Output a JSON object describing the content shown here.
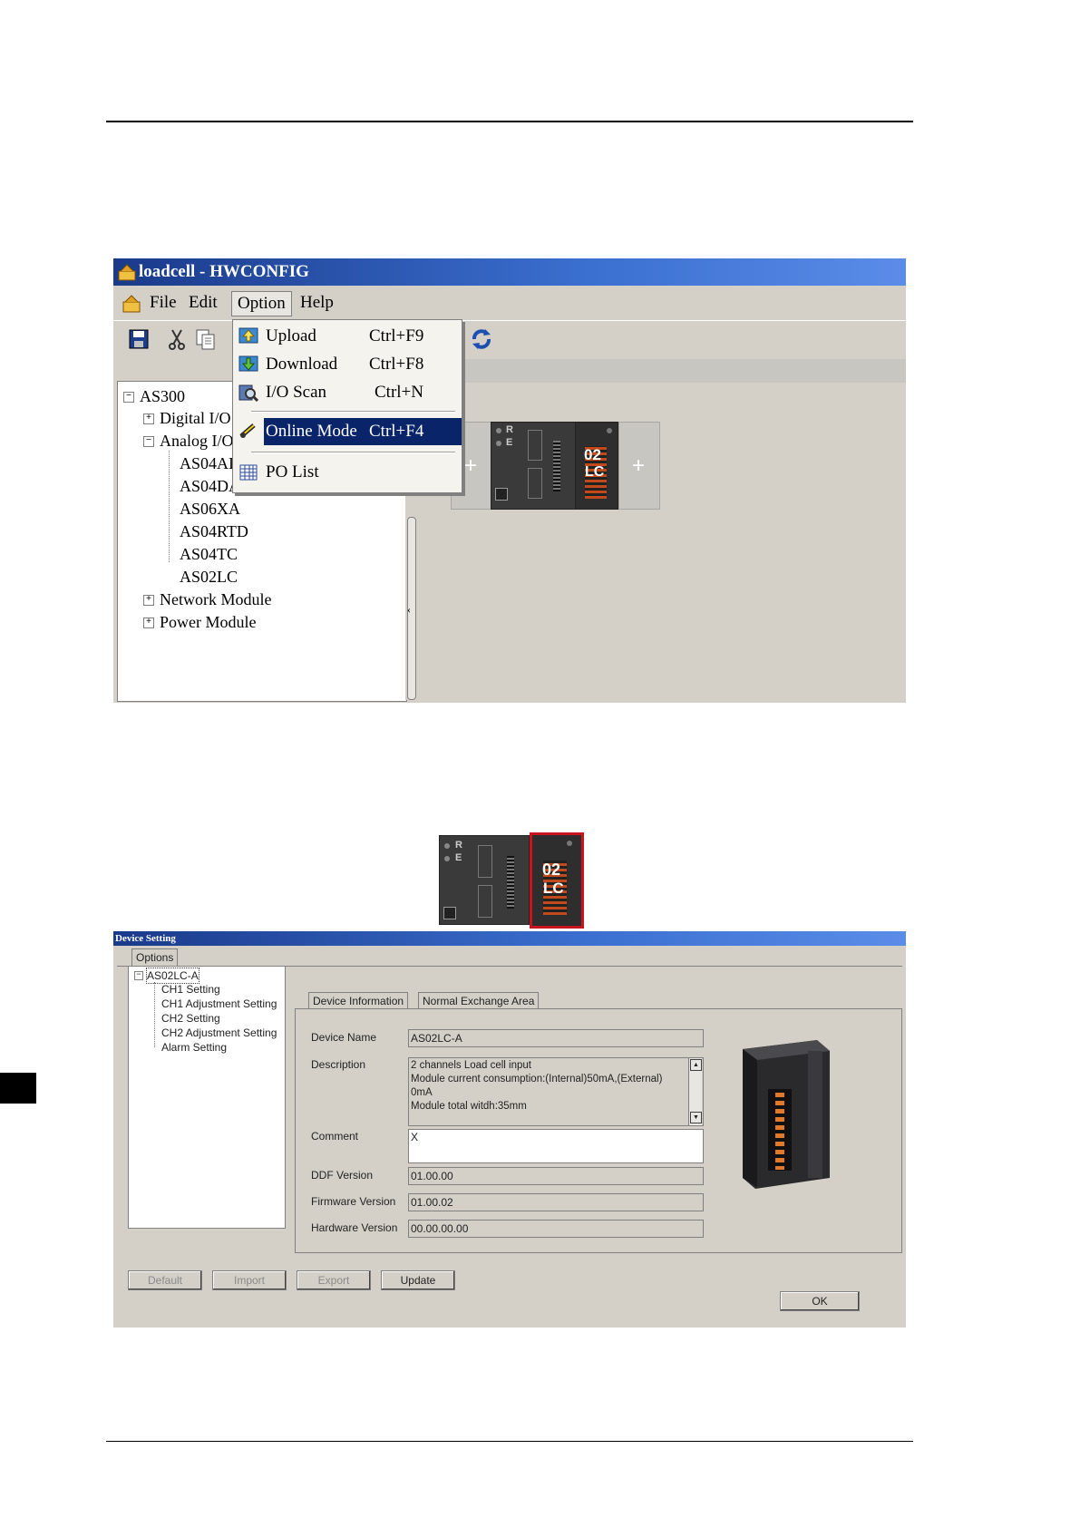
{
  "hwconfig": {
    "title": "loadcell - HWCONFIG",
    "menu": [
      "File",
      "Edit",
      "Option",
      "Help"
    ],
    "dropdown": [
      {
        "label": "Upload",
        "shortcut": "Ctrl+F9",
        "icon": "upload-icon"
      },
      {
        "label": "Download",
        "shortcut": "Ctrl+F8",
        "icon": "download-icon"
      },
      {
        "label": "I/O Scan",
        "shortcut": "Ctrl+N",
        "icon": "io-scan-icon"
      },
      {
        "label": "Online Mode",
        "shortcut": "Ctrl+F4",
        "icon": "online-mode-icon",
        "highlighted": true
      },
      {
        "label": "PO List",
        "shortcut": "",
        "icon": "po-list-icon"
      }
    ],
    "tree": {
      "root": "AS300",
      "items": [
        "Digital I/O M",
        "Analog I/O",
        "AS04AI",
        "AS04DA",
        "AS06XA",
        "AS04RTD",
        "AS04TC",
        "AS02LC",
        "Network Module",
        "Power Module"
      ]
    },
    "rack": {
      "cpu_letters": [
        "R",
        "E"
      ],
      "module_label_top": "02",
      "module_label_bottom": "LC"
    }
  },
  "module_preview": {
    "cpu_letters": [
      "R",
      "E"
    ],
    "module_label_top": "02",
    "module_label_bottom": "LC",
    "selected_color": "#c8141e"
  },
  "device_setting": {
    "title": "Device Setting",
    "options_tab": "Options",
    "tree": {
      "root": "AS02LC-A",
      "items": [
        "CH1 Setting",
        "CH1 Adjustment Setting",
        "CH2 Setting",
        "CH2 Adjustment Setting",
        "Alarm Setting"
      ]
    },
    "tabs": [
      "Device Information",
      "Normal Exchange Area"
    ],
    "fields": {
      "device_name_label": "Device Name",
      "device_name": "AS02LC-A",
      "description_label": "Description",
      "description_lines": [
        "2 channels Load cell input",
        "Module current consumption:(Internal)50mA,(External)",
        "0mA",
        "Module total witdh:35mm"
      ],
      "comment_label": "Comment",
      "comment": "X",
      "ddf_version_label": "DDF Version",
      "ddf_version": "01.00.00",
      "firmware_version_label": "Firmware Version",
      "firmware_version": "01.00.02",
      "hardware_version_label": "Hardware Version",
      "hardware_version": "00.00.00.00"
    },
    "buttons": {
      "default": "Default",
      "import": "Import",
      "export": "Export",
      "update": "Update",
      "ok": "OK"
    }
  }
}
